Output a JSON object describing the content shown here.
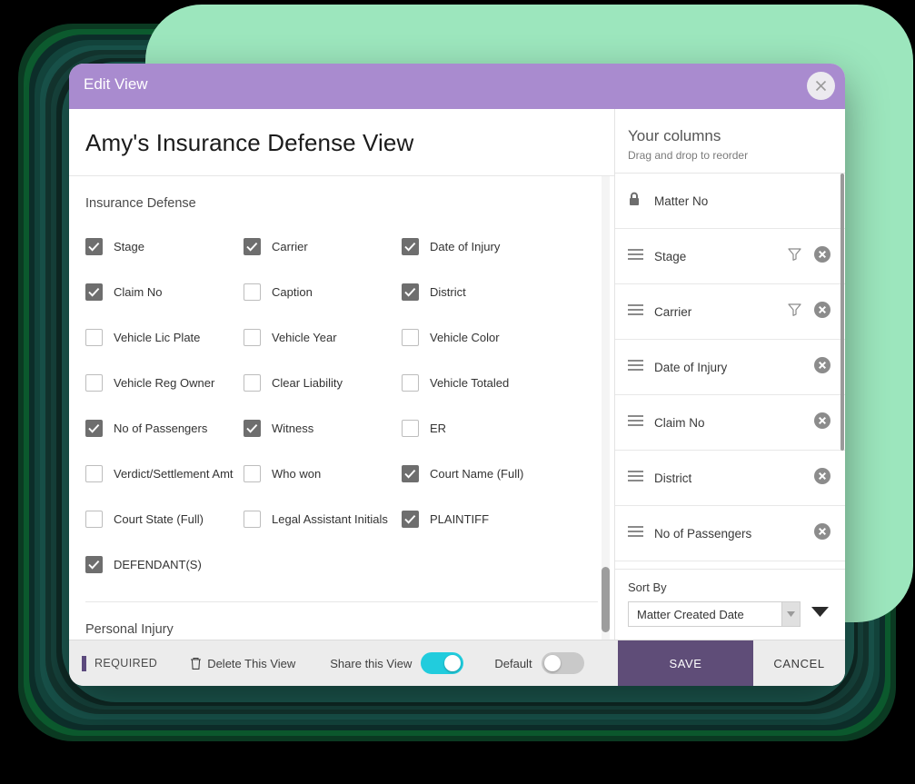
{
  "dialog": {
    "title": "Edit View",
    "close_icon": "close-icon",
    "view_name": "Amy's Insurance Defense View"
  },
  "left_panel": {
    "sections": [
      {
        "title": "Insurance Defense",
        "fields": [
          {
            "label": "Stage",
            "checked": true
          },
          {
            "label": "Carrier",
            "checked": true
          },
          {
            "label": "Date of Injury",
            "checked": true
          },
          {
            "label": "Claim No",
            "checked": true
          },
          {
            "label": "Caption",
            "checked": false
          },
          {
            "label": "District",
            "checked": true
          },
          {
            "label": "Vehicle Lic Plate",
            "checked": false
          },
          {
            "label": "Vehicle Year",
            "checked": false
          },
          {
            "label": "Vehicle Color",
            "checked": false
          },
          {
            "label": "Vehicle Reg Owner",
            "checked": false
          },
          {
            "label": "Clear Liability",
            "checked": false
          },
          {
            "label": "Vehicle Totaled",
            "checked": false
          },
          {
            "label": "No of Passengers",
            "checked": true
          },
          {
            "label": "Witness",
            "checked": true
          },
          {
            "label": "ER",
            "checked": false
          },
          {
            "label": "Verdict/Settlement Amt",
            "checked": false
          },
          {
            "label": "Who won",
            "checked": false
          },
          {
            "label": "Court Name (Full)",
            "checked": true
          },
          {
            "label": "Court State (Full)",
            "checked": false
          },
          {
            "label": "Legal Assistant Initials",
            "checked": false
          },
          {
            "label": "PLAINTIFF",
            "checked": true
          },
          {
            "label": "DEFENDANT(S)",
            "checked": true
          }
        ]
      },
      {
        "title": "Personal Injury",
        "fields": [
          {
            "label": "",
            "checked": false
          },
          {
            "label": "",
            "checked": false
          },
          {
            "label": "",
            "checked": false
          }
        ]
      }
    ]
  },
  "right_panel": {
    "title": "Your columns",
    "subtitle": "Drag and drop to reorder",
    "columns": [
      {
        "name": "Matter No",
        "locked": true,
        "filter": false,
        "removable": false
      },
      {
        "name": "Stage",
        "locked": false,
        "filter": true,
        "removable": true
      },
      {
        "name": "Carrier",
        "locked": false,
        "filter": true,
        "removable": true
      },
      {
        "name": "Date of Injury",
        "locked": false,
        "filter": false,
        "removable": true
      },
      {
        "name": "Claim No",
        "locked": false,
        "filter": false,
        "removable": true
      },
      {
        "name": "District",
        "locked": false,
        "filter": false,
        "removable": true
      },
      {
        "name": "No of Passengers",
        "locked": false,
        "filter": false,
        "removable": true
      }
    ],
    "sort": {
      "label": "Sort By",
      "value": "Matter Created Date",
      "direction_icon": "sort-descending-icon"
    }
  },
  "footer": {
    "required_label": "REQUIRED",
    "delete_label": "Delete This View",
    "delete_icon": "trash-icon",
    "share_label": "Share this View",
    "share_enabled": true,
    "default_label": "Default",
    "default_enabled": false,
    "save_label": "SAVE",
    "cancel_label": "CANCEL"
  },
  "colors": {
    "titlebar": "#a98bcf",
    "save_button": "#5f4d78",
    "toggle_on": "#21ccdd",
    "toggle_off": "#c9c9c9",
    "checkbox_checked": "#6e6e6e",
    "backdrop_mint": "#9ce6bd",
    "required_marker": "#5c4a7d"
  }
}
